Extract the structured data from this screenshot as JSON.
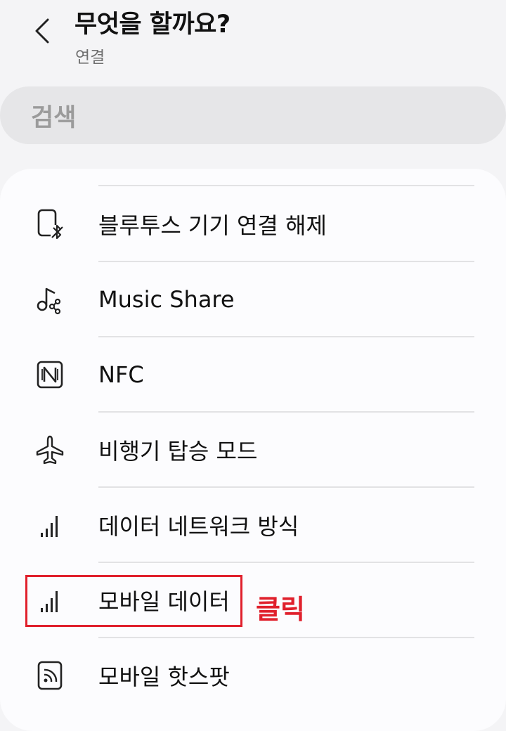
{
  "header": {
    "title": "무엇을 할까요?",
    "subtitle": "연결"
  },
  "search": {
    "label": "검색"
  },
  "items": [
    {
      "label": "블루투스 기기 연결 해제",
      "icon": "bluetooth-disconnect-icon"
    },
    {
      "label": "Music Share",
      "icon": "music-share-icon"
    },
    {
      "label": "NFC",
      "icon": "nfc-icon"
    },
    {
      "label": "비행기 탑승 모드",
      "icon": "airplane-icon"
    },
    {
      "label": "데이터 네트워크 방식",
      "icon": "signal-bars-icon"
    },
    {
      "label": "모바일 데이터",
      "icon": "signal-bars-icon"
    },
    {
      "label": "모바일 핫스팟",
      "icon": "hotspot-icon"
    }
  ],
  "annotation": {
    "text": "클릭",
    "color": "#e0202c"
  }
}
